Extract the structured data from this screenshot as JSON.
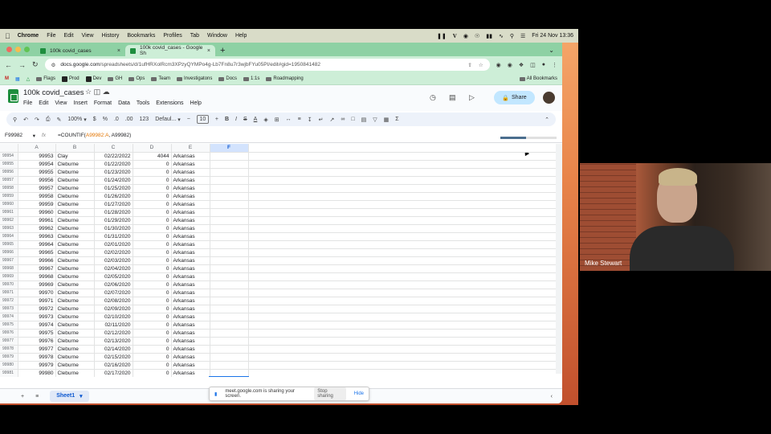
{
  "mac_menubar": {
    "app": "Chrome",
    "items": [
      "File",
      "Edit",
      "View",
      "History",
      "Bookmarks",
      "Profiles",
      "Tab",
      "Window",
      "Help"
    ],
    "clock": "Fri 24 Nov  13:36"
  },
  "browser": {
    "tabs": [
      {
        "title": "100k covid_cases",
        "active": false
      },
      {
        "title": "100k covid_cases - Google Sh",
        "active": true
      }
    ],
    "url_domain": "docs.google.com",
    "url_path": "/spreadsheets/d/1ufHRXolRcm3XPzyQYMPo4g-Lb7Fn8u7r3wjbFYu05PI/edit#gid=1950841482",
    "bookmarks": [
      "Flags",
      "Prod",
      "Dev",
      "GH",
      "Ops",
      "Team",
      "Investigatons",
      "Docs",
      "1:1s",
      "Roadmapping"
    ],
    "all_bookmarks": "All Bookmarks"
  },
  "sheets": {
    "title": "100k covid_cases",
    "menu": [
      "File",
      "Edit",
      "View",
      "Insert",
      "Format",
      "Data",
      "Tools",
      "Extensions",
      "Help"
    ],
    "share_label": "Share",
    "toolbar": {
      "zoom": "100%",
      "font": "Defaul...",
      "font_size": "10",
      "currency": "$",
      "percent": "%",
      "dec_dec": ".0",
      "inc_dec": ".00",
      "fmt": "123"
    },
    "name_box": "F99982",
    "fx": "fx",
    "formula_prefix": "=COUNTIF(",
    "formula_range1": "A99982:A",
    "formula_suffix": ", A99982)",
    "loading_progress": 0.45,
    "columns": [
      "A",
      "B",
      "C",
      "D",
      "E",
      "F"
    ],
    "rows": [
      {
        "r": "99954",
        "a": "99953",
        "b": "Clay",
        "c": "02/22/2022",
        "d": "4044",
        "e": "Arkansas"
      },
      {
        "r": "99955",
        "a": "99954",
        "b": "Cleburne",
        "c": "01/22/2020",
        "d": "0",
        "e": "Arkansas"
      },
      {
        "r": "99956",
        "a": "99955",
        "b": "Cleburne",
        "c": "01/23/2020",
        "d": "0",
        "e": "Arkansas"
      },
      {
        "r": "99957",
        "a": "99956",
        "b": "Cleburne",
        "c": "01/24/2020",
        "d": "0",
        "e": "Arkansas"
      },
      {
        "r": "99958",
        "a": "99957",
        "b": "Cleburne",
        "c": "01/25/2020",
        "d": "0",
        "e": "Arkansas"
      },
      {
        "r": "99959",
        "a": "99958",
        "b": "Cleburne",
        "c": "01/26/2020",
        "d": "0",
        "e": "Arkansas"
      },
      {
        "r": "99960",
        "a": "99959",
        "b": "Cleburne",
        "c": "01/27/2020",
        "d": "0",
        "e": "Arkansas"
      },
      {
        "r": "99961",
        "a": "99960",
        "b": "Cleburne",
        "c": "01/28/2020",
        "d": "0",
        "e": "Arkansas"
      },
      {
        "r": "99962",
        "a": "99961",
        "b": "Cleburne",
        "c": "01/29/2020",
        "d": "0",
        "e": "Arkansas"
      },
      {
        "r": "99963",
        "a": "99962",
        "b": "Cleburne",
        "c": "01/30/2020",
        "d": "0",
        "e": "Arkansas"
      },
      {
        "r": "99964",
        "a": "99963",
        "b": "Cleburne",
        "c": "01/31/2020",
        "d": "0",
        "e": "Arkansas"
      },
      {
        "r": "99965",
        "a": "99964",
        "b": "Cleburne",
        "c": "02/01/2020",
        "d": "0",
        "e": "Arkansas"
      },
      {
        "r": "99966",
        "a": "99965",
        "b": "Cleburne",
        "c": "02/02/2020",
        "d": "0",
        "e": "Arkansas"
      },
      {
        "r": "99967",
        "a": "99966",
        "b": "Cleburne",
        "c": "02/03/2020",
        "d": "0",
        "e": "Arkansas"
      },
      {
        "r": "99968",
        "a": "99967",
        "b": "Cleburne",
        "c": "02/04/2020",
        "d": "0",
        "e": "Arkansas"
      },
      {
        "r": "99969",
        "a": "99968",
        "b": "Cleburne",
        "c": "02/05/2020",
        "d": "0",
        "e": "Arkansas"
      },
      {
        "r": "99970",
        "a": "99969",
        "b": "Cleburne",
        "c": "02/06/2020",
        "d": "0",
        "e": "Arkansas"
      },
      {
        "r": "99971",
        "a": "99970",
        "b": "Cleburne",
        "c": "02/07/2020",
        "d": "0",
        "e": "Arkansas"
      },
      {
        "r": "99972",
        "a": "99971",
        "b": "Cleburne",
        "c": "02/08/2020",
        "d": "0",
        "e": "Arkansas"
      },
      {
        "r": "99973",
        "a": "99972",
        "b": "Cleburne",
        "c": "02/09/2020",
        "d": "0",
        "e": "Arkansas"
      },
      {
        "r": "99974",
        "a": "99973",
        "b": "Cleburne",
        "c": "02/10/2020",
        "d": "0",
        "e": "Arkansas"
      },
      {
        "r": "99975",
        "a": "99974",
        "b": "Cleburne",
        "c": "02/11/2020",
        "d": "0",
        "e": "Arkansas"
      },
      {
        "r": "99976",
        "a": "99975",
        "b": "Cleburne",
        "c": "02/12/2020",
        "d": "0",
        "e": "Arkansas"
      },
      {
        "r": "99977",
        "a": "99976",
        "b": "Cleburne",
        "c": "02/13/2020",
        "d": "0",
        "e": "Arkansas"
      },
      {
        "r": "99978",
        "a": "99977",
        "b": "Cleburne",
        "c": "02/14/2020",
        "d": "0",
        "e": "Arkansas"
      },
      {
        "r": "99979",
        "a": "99978",
        "b": "Cleburne",
        "c": "02/15/2020",
        "d": "0",
        "e": "Arkansas"
      },
      {
        "r": "99980",
        "a": "99979",
        "b": "Cleburne",
        "c": "02/16/2020",
        "d": "0",
        "e": "Arkansas"
      },
      {
        "r": "99981",
        "a": "99980",
        "b": "Cleburne",
        "c": "02/17/2020",
        "d": "0",
        "e": "Arkansas"
      }
    ],
    "sheet_tab": "Sheet1"
  },
  "screen_share": {
    "message": "meet.google.com is sharing your screen.",
    "stop": "Stop sharing",
    "hide": "Hide"
  },
  "video": {
    "participant": "Mike Stewart"
  },
  "colors": {
    "accent": "#1a73e8",
    "share_bg": "#c2e7ff",
    "tab_green": "#8ed1a4"
  }
}
